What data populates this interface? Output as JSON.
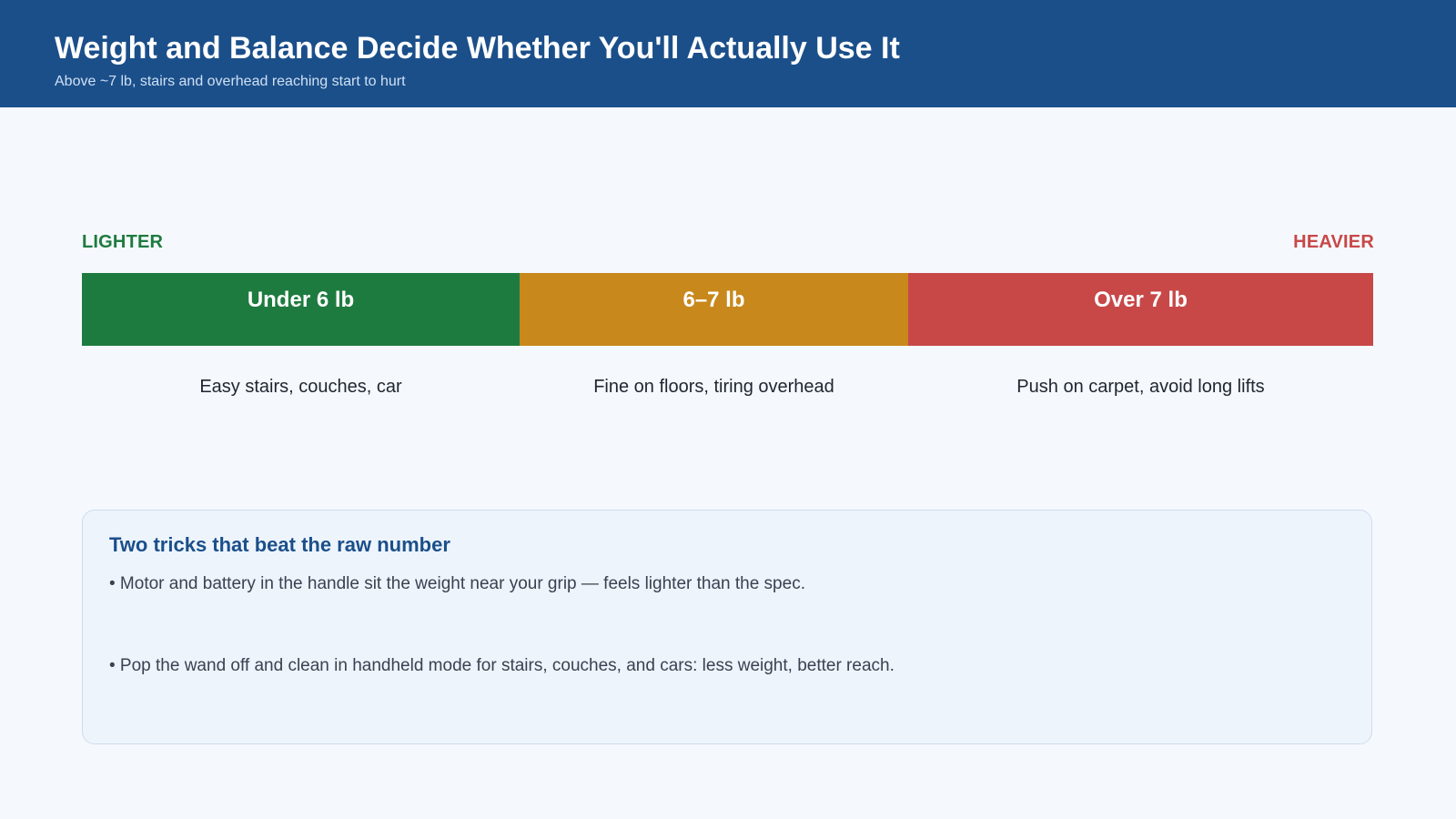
{
  "header": {
    "title": "Weight and Balance Decide Whether You'll Actually Use It",
    "subtitle": "Above ~7 lb, stairs and overhead reaching start to hurt",
    "background": "#1b4f8a"
  },
  "scale": {
    "left_label": "LIGHTER",
    "right_label": "HEAVIER",
    "segments": [
      {
        "label": "Under 6 lb",
        "description": "Easy stairs, couches, car",
        "color": "#1e7b3f",
        "share": 0.339
      },
      {
        "label": "6–7 lb",
        "description": "Fine on floors, tiring overhead",
        "color": "#c8881c",
        "share": 0.301
      },
      {
        "label": "Over 7 lb",
        "description": "Push on carpet, avoid long lifts",
        "color": "#c84848",
        "share": 0.36
      }
    ]
  },
  "tips": {
    "title": "Two tricks that beat the raw number",
    "items": [
      "• Motor and battery in the handle sit the weight near your grip — feels lighter than the spec.",
      "• Pop the wand off and clean in handheld mode for stairs, couches, and cars: less weight, better reach."
    ]
  }
}
